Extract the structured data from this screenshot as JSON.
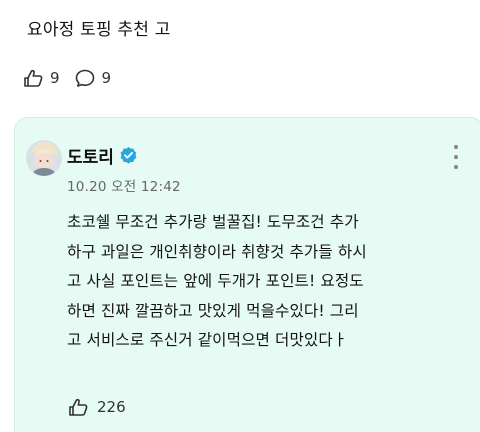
{
  "post": {
    "text": "요아정 토핑 추천 고",
    "like_count": "9",
    "reply_count": "9"
  },
  "comment": {
    "author": "도토리",
    "timestamp": "10.20 오전 12:42",
    "lines": [
      "초코쉘 무조건 추가랑 벌꿀집! 도무조건 추가",
      "하구 과일은 개인취향이라 취향것 추가들 하시",
      "고 사실 포인트는 앞에 두개가 포인트! 요정도",
      "하면 진짜 깔끔하고 맛있게 먹을수있다! 그리",
      "고 서비스로 주신거 같이먹으면 더맛있다ㅏ"
    ],
    "like_count": "226"
  },
  "icons": {
    "like": "like-hand-icon",
    "reply": "speech-bubble-icon",
    "verified": "verified-badge-icon",
    "more": "more-vertical-icon",
    "verified_color": "#2aa5e0"
  }
}
